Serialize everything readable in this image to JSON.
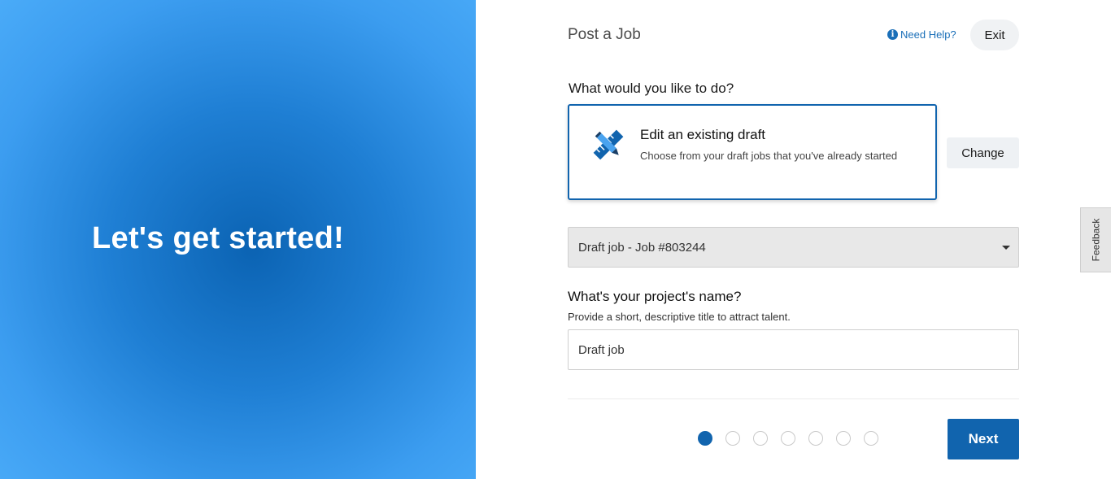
{
  "hero": {
    "title": "Let's get started!"
  },
  "header": {
    "title": "Post a Job",
    "help_label": "Need Help?",
    "exit_label": "Exit"
  },
  "main": {
    "question": "What would you like to do?",
    "option": {
      "title": "Edit an existing draft",
      "description": "Choose from your draft jobs that you've already started",
      "icon": "pencil-ruler-icon"
    },
    "change_label": "Change",
    "draft_select": {
      "value": "Draft job - Job #803244"
    },
    "project_name": {
      "label": "What's your project's name?",
      "hint": "Provide a short, descriptive title to attract talent.",
      "value": "Draft job"
    },
    "steps": {
      "total": 7,
      "current": 1
    },
    "next_label": "Next"
  },
  "feedback": {
    "label": "Feedback"
  },
  "colors": {
    "accent": "#1164ae",
    "hero_gradient_center": "#0b63b3",
    "hero_gradient_edge": "#4aabf8"
  }
}
